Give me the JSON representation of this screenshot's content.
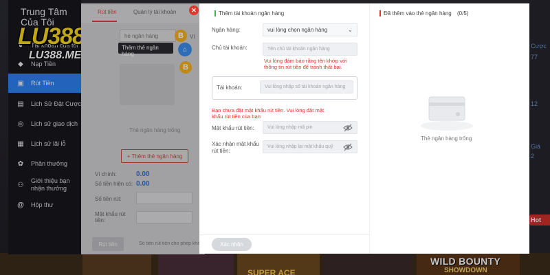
{
  "sidebar": {
    "title_line1": "Trung Tâm",
    "title_line2": "Của Tôi",
    "logo": "LU388",
    "logo_sub": "LU388.ME",
    "items": [
      {
        "label": "Tài khoản của tôi",
        "icon": "user-icon"
      },
      {
        "label": "Nạp Tiền",
        "icon": "deposit-icon"
      },
      {
        "label": "Rút Tiền",
        "icon": "withdraw-icon",
        "active": true
      },
      {
        "label": "Lịch Sử Đặt Cược",
        "icon": "bet-history-icon"
      },
      {
        "label": "Lịch sử giao dịch",
        "icon": "transaction-icon"
      },
      {
        "label": "Lịch sử lãi lỗ",
        "icon": "profit-icon"
      },
      {
        "label": "Phần thưởng",
        "icon": "gift-icon"
      },
      {
        "label_line1": "Giới thiệu bạn",
        "label_line2": "nhận thưởng",
        "icon": "referral-icon"
      },
      {
        "label": "Hộp thư",
        "icon": "mail-icon"
      }
    ]
  },
  "back_panel": {
    "tab_withdraw": "Rút tiền",
    "tab_manage": "Quản lý tài khoản",
    "bank_input": "hẻ ngân hàng",
    "tooltip": "Thêm thẻ ngân hàng",
    "wallet_label": "Ví",
    "empty_text": "Thẻ ngân hàng trống",
    "add_card": "+ Thêm thẻ ngân hàng",
    "wallet_row": "Ví chính:",
    "wallet_value": "0.00",
    "withdrawable_row": "Số tiền hiện có:",
    "withdrawable_value": "0.00",
    "amount_row": "Số tiền rút:",
    "password_row_1": "Mật khẩu rút",
    "password_row_2": "tiền:",
    "withdraw_btn": "Rút tiền",
    "note": "Số tiền rút tiền cho phép khả"
  },
  "modal": {
    "left_title": "Thêm tài khoản ngân hàng",
    "bank_label": "Ngân hàng:",
    "bank_select": "vui lòng chọn ngân hàng",
    "holder_label": "Chủ tài khoản:",
    "holder_placeholder": "Tên chủ tài khoản ngân hàng",
    "holder_warn_1": "Vui lòng đảm bảo rằng tên khớp với",
    "holder_warn_2": "thông tin rút tiền để tránh thất bại.",
    "account_label": "Tài khoản:",
    "account_placeholder": "Vui lòng nhập số tài khoản ngân hàng",
    "pw_warn_1": "Bạn chưa đặt mật khẩu rút tiền. Vui lòng đặt mật",
    "pw_warn_2": "khẩu rút tiền của bạn",
    "pw_label": "Mật khẩu rút tiền:",
    "pw_placeholder": "Vui lòng nhập mã pin",
    "confirm_label_1": "Xác nhận mật khẩu",
    "confirm_label_2": "rút tiền:",
    "confirm_placeholder": "Vui lòng nhập lại mật khẩu quỹ",
    "confirm_btn": "Xác nhận",
    "right_title": "Đã thêm vào thẻ ngân hàng",
    "right_count": "(0/5)",
    "right_empty": "Thẻ ngân hàng trống"
  },
  "background": {
    "right_labels": [
      "Cược",
      "77",
      "12",
      "Giá",
      "2"
    ],
    "hot": "Hot",
    "game1": "SUPER ACE",
    "game2_line1": "WILD BOUNTY",
    "game2_line2": "SHOWDOWN"
  },
  "colors": {
    "accent": "#2d7ff0",
    "danger": "#e0352b",
    "success": "#3ab54a",
    "logo": "#f7d61d"
  }
}
